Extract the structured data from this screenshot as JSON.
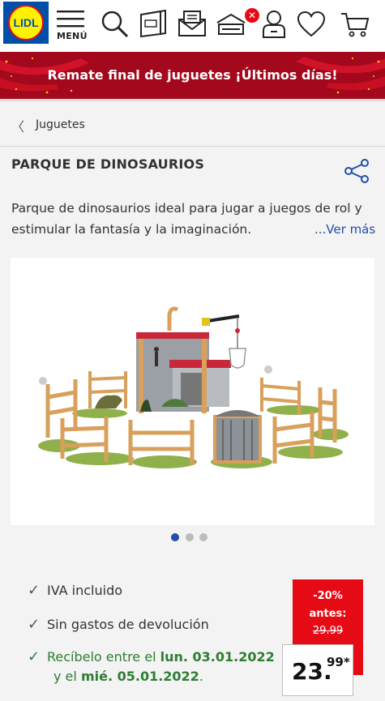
{
  "header": {
    "logo_text": "LIDL",
    "menu_label": "MENÚ",
    "cart_badge": "✕",
    "icons": [
      "menu-icon",
      "search-icon",
      "brochure-icon",
      "mail-icon",
      "store-icon",
      "account-icon",
      "heart-icon",
      "cart-icon"
    ]
  },
  "promo": {
    "text": "Remate final de juguetes ¡Últimos días!",
    "bg_color": "#a3081c"
  },
  "breadcrumb": {
    "label": "Juguetes"
  },
  "product": {
    "title": "PARQUE DE DINOSAURIOS",
    "description": "Parque de dinosaurios ideal para jugar a juegos de rol y estimular la fantasía y la imaginación.",
    "more_link": "...Ver más",
    "image_alt": "Parque de dinosaurios",
    "carousel": {
      "count": 3,
      "active": 0
    }
  },
  "features": {
    "vat": "IVA incluido",
    "returns": "Sin gastos de devolución",
    "delivery_prefix": "Recíbelo entre el ",
    "delivery_date1": "lun. 03.01.2022",
    "delivery_mid": "y el ",
    "delivery_date2": "mié. 05.01.2022",
    "delivery_suffix": "."
  },
  "price": {
    "discount": "-20%",
    "before_label": "antes:",
    "old_price": "29.99",
    "price_int": "23.",
    "price_dec": "99*",
    "accent": "#e60a14"
  }
}
